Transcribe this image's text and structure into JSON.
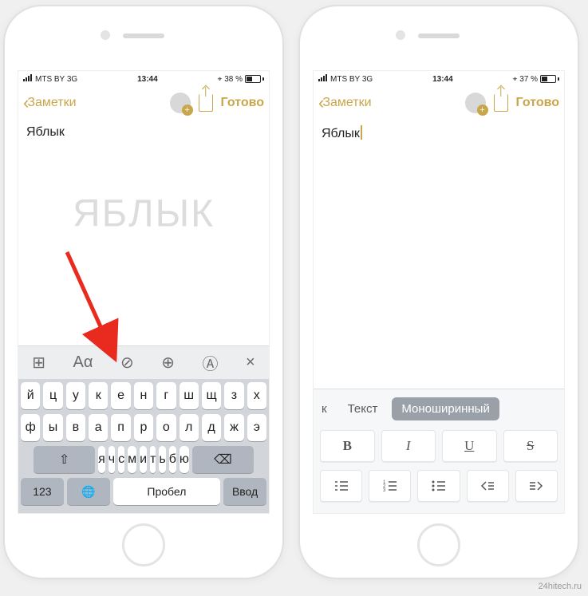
{
  "credit": "24hitech.ru",
  "phone1": {
    "status": {
      "carrier": "MTS BY  3G",
      "time": "13:44",
      "battery": "38 %"
    },
    "nav": {
      "back": "Заметки",
      "done": "Готово"
    },
    "note_text": "Яблык",
    "watermark": "ЯБЛЫК",
    "toolbar": {
      "table": "⊞",
      "aa": "Aα",
      "check": "⊘",
      "plus": "⊕",
      "draw": "Ⓐ",
      "close": "×"
    },
    "keyboard": {
      "row1": [
        "й",
        "ц",
        "у",
        "к",
        "е",
        "н",
        "г",
        "ш",
        "щ",
        "з",
        "х"
      ],
      "row2": [
        "ф",
        "ы",
        "в",
        "а",
        "п",
        "р",
        "о",
        "л",
        "д",
        "ж",
        "э"
      ],
      "row3": [
        "я",
        "ч",
        "с",
        "м",
        "и",
        "т",
        "ь",
        "б",
        "ю"
      ],
      "num": "123",
      "space": "Пробел",
      "enter": "Ввод"
    }
  },
  "phone2": {
    "status": {
      "carrier": "MTS BY  3G",
      "time": "13:44",
      "battery": "37 %"
    },
    "nav": {
      "back": "Заметки",
      "done": "Готово"
    },
    "note_text": "Яблык",
    "format": {
      "styles": {
        "partial": "к",
        "text": "Текст",
        "mono": "Моноширинный"
      },
      "buttons": {
        "b": "B",
        "i": "I",
        "u": "U",
        "s": "S"
      }
    }
  }
}
